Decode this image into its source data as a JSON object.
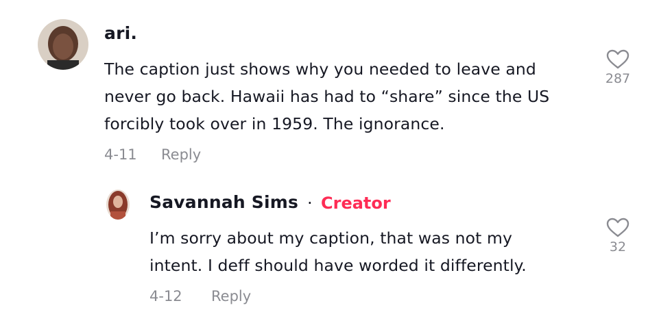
{
  "comment": {
    "username": "ari.",
    "text_line1": "The caption just shows why you needed to leave and",
    "text_line2": "never go back. Hawaii has had to “share” since the US",
    "text_line3": "forcibly took over in 1959. The ignorance.",
    "date": "4-11",
    "reply_label": "Reply",
    "likes": "287",
    "icons": {
      "avatar": "avatar",
      "like": "heart-icon"
    }
  },
  "reply": {
    "username": "Savannah Sims",
    "separator": "·",
    "badge": "Creator",
    "text_line1": "I’m sorry about my caption, that was not my",
    "text_line2": "intent. I deff should have worded it differently.",
    "date": "4-12",
    "reply_label": "Reply",
    "likes": "32",
    "icons": {
      "avatar": "avatar",
      "like": "heart-icon"
    }
  },
  "colors": {
    "text": "#161823",
    "muted": "#8a8b91",
    "creator": "#fe2c55"
  }
}
